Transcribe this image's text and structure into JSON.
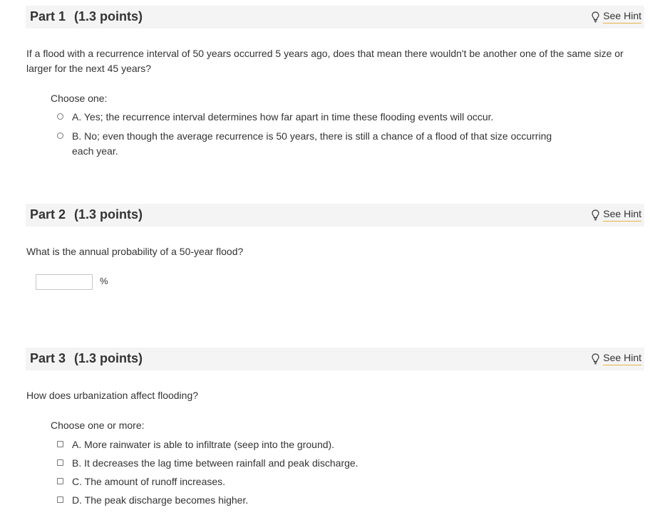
{
  "parts": [
    {
      "title": "Part 1",
      "points": "(1.3 points)",
      "hint_label": "See Hint",
      "question": "If a flood with a recurrence interval of 50 years occurred 5 years ago, does that mean there wouldn't be another one of the same size or larger for the next 45 years?",
      "choose_label": "Choose one:",
      "options": [
        "A. Yes; the recurrence interval determines how far apart in time these flooding events will occur.",
        "B. No; even though the average recurrence is 50 years, there is still a chance of a flood of that size occurring each year."
      ]
    },
    {
      "title": "Part 2",
      "points": "(1.3 points)",
      "hint_label": "See Hint",
      "question": "What is the annual probability of a 50-year flood?",
      "input_value": "",
      "unit": "%"
    },
    {
      "title": "Part 3",
      "points": "(1.3 points)",
      "hint_label": "See Hint",
      "question": "How does urbanization affect flooding?",
      "choose_label": "Choose one or more:",
      "options": [
        "A. More rainwater is able to infiltrate (seep into the ground).",
        "B. It decreases the lag time between rainfall and peak discharge.",
        "C. The amount of runoff increases.",
        "D. The peak discharge becomes higher."
      ]
    }
  ],
  "icons": {
    "hint": "lightbulb-icon",
    "single_choice": "radio-circle",
    "multi_choice": "checkbox-square"
  },
  "colors": {
    "header_background": "#f4f4f4",
    "hint_underline": "#e3b34b",
    "text": "#333333"
  }
}
